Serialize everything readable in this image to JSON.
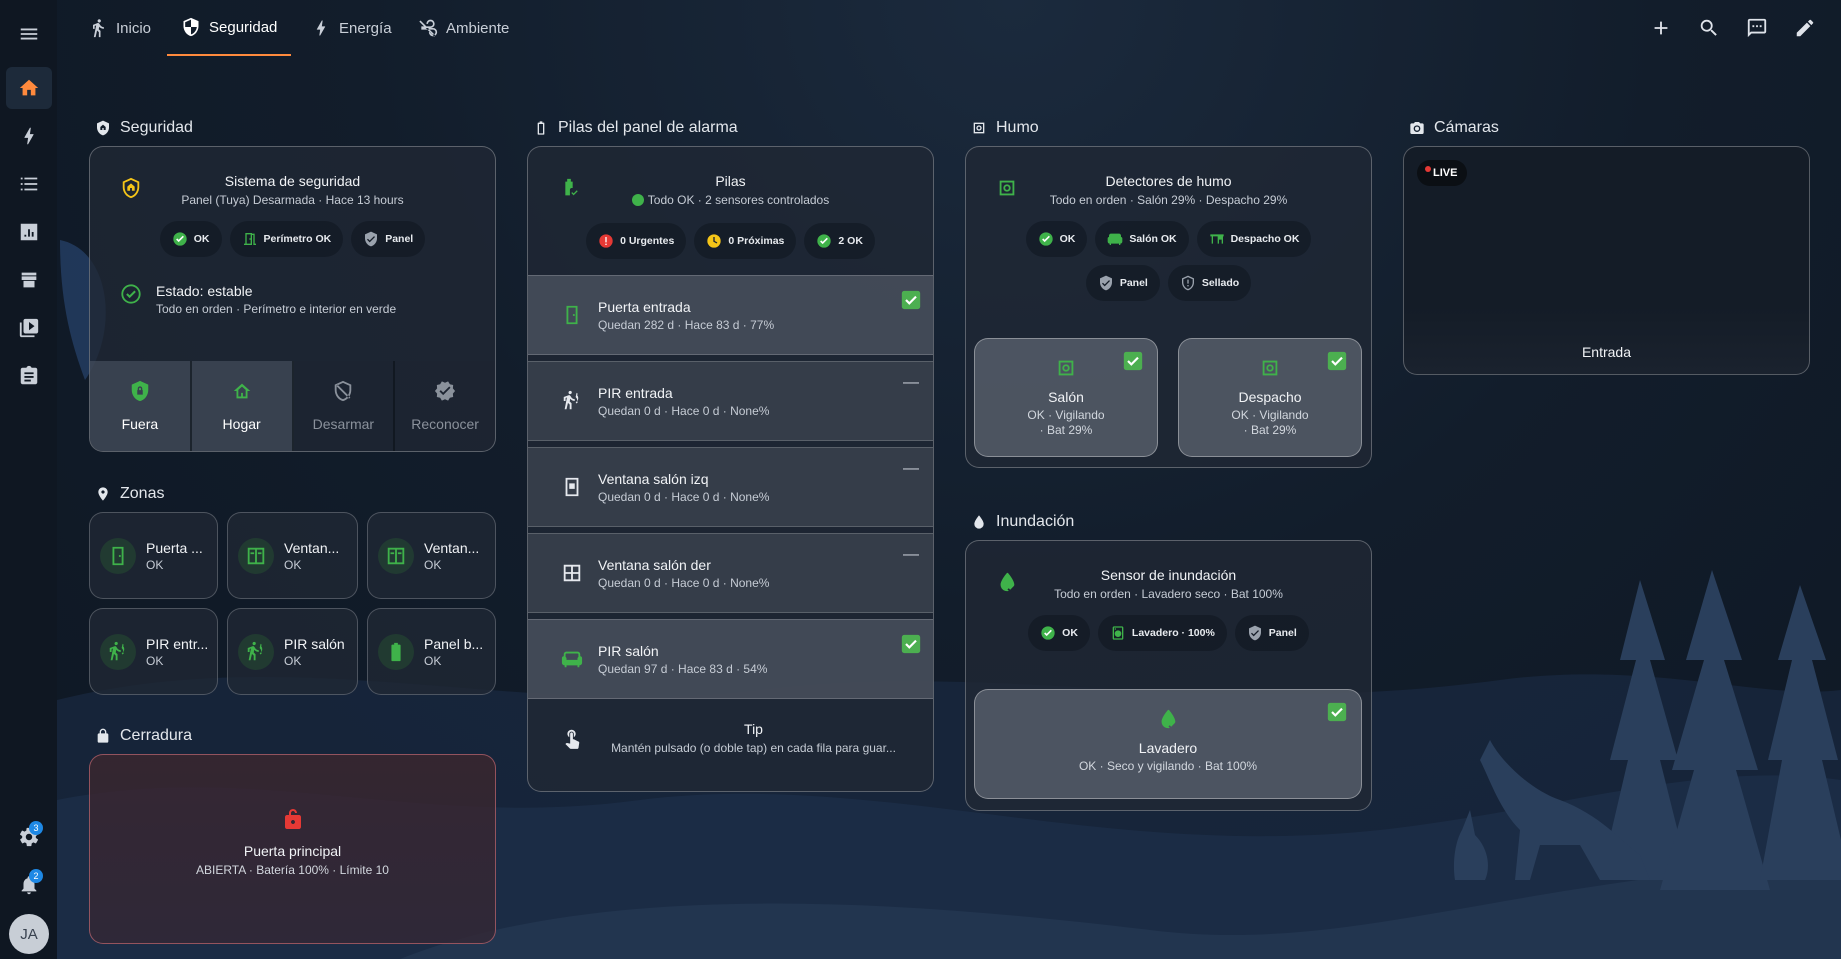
{
  "topbar": {
    "tabs": [
      {
        "label": "Inicio",
        "icon": "walk-icon",
        "active": false
      },
      {
        "label": "Seguridad",
        "icon": "shield-icon",
        "active": true
      },
      {
        "label": "Energía",
        "icon": "lightning-icon",
        "active": false
      },
      {
        "label": "Ambiente",
        "icon": "weather-icon",
        "active": false
      }
    ],
    "actions": [
      "add-icon",
      "search-icon",
      "chat-icon",
      "edit-icon"
    ]
  },
  "sidebar": {
    "items": [
      "home-icon",
      "energy-icon",
      "list-icon",
      "chart-icon",
      "store-icon",
      "media-icon",
      "clipboard-icon"
    ],
    "settings_badge": "3",
    "notifications_badge": "2",
    "avatar_initials": "JA"
  },
  "security": {
    "section_title": "Seguridad",
    "title": "Sistema de seguridad",
    "subtitle": "Panel (Tuya) Desarmada · Hace 13 hours",
    "chips": [
      "OK",
      "Perímetro OK",
      "Panel"
    ],
    "status_title": "Estado: estable",
    "status_detail": "Todo en orden · Perímetro e interior en verde",
    "modes": [
      {
        "label": "Fuera",
        "enabled": true
      },
      {
        "label": "Hogar",
        "enabled": true
      },
      {
        "label": "Desarmar",
        "enabled": false
      },
      {
        "label": "Reconocer",
        "enabled": false
      }
    ]
  },
  "zones": {
    "section_title": "Zonas",
    "items": [
      {
        "name": "Puerta ...",
        "state": "OK",
        "icon": "door-icon"
      },
      {
        "name": "Ventan...",
        "state": "OK",
        "icon": "window-icon"
      },
      {
        "name": "Ventan...",
        "state": "OK",
        "icon": "window-icon"
      },
      {
        "name": "PIR entr...",
        "state": "OK",
        "icon": "motion-sensor-icon"
      },
      {
        "name": "PIR salón",
        "state": "OK",
        "icon": "motion-sensor-icon"
      },
      {
        "name": "Panel b...",
        "state": "OK",
        "icon": "battery-icon"
      }
    ]
  },
  "lock": {
    "section_title": "Cerradura",
    "name": "Puerta principal",
    "detail": "ABIERTA · Batería 100% · Límite 10"
  },
  "batteries": {
    "section_title": "Pilas del panel de alarma",
    "title": "Pilas",
    "subtitle": "Todo OK · 2 sensores controlados",
    "chips": [
      "0 Urgentes",
      "0 Próximas",
      "2 OK"
    ],
    "rows": [
      {
        "name": "Puerta entrada",
        "detail": "Quedan 282 d · Hace 83 d · 77%",
        "flag": "check"
      },
      {
        "name": "PIR entrada",
        "detail": "Quedan 0 d · Hace 0 d · None%",
        "flag": "dash"
      },
      {
        "name": "Ventana salón izq",
        "detail": "Quedan 0 d · Hace 0 d · None%",
        "flag": "dash"
      },
      {
        "name": "Ventana salón der",
        "detail": "Quedan 0 d · Hace 0 d · None%",
        "flag": "dash"
      },
      {
        "name": "PIR salón",
        "detail": "Quedan 97 d · Hace 83 d · 54%",
        "flag": "check"
      }
    ],
    "tip_title": "Tip",
    "tip_text": "Mantén pulsado (o doble tap) en cada fila para guar..."
  },
  "smoke": {
    "section_title": "Humo",
    "title": "Detectores de humo",
    "subtitle": "Todo en orden · Salón 29% · Despacho 29%",
    "chips": [
      "OK",
      "Salón OK",
      "Despacho OK",
      "Panel",
      "Sellado"
    ],
    "detectors": [
      {
        "name": "Salón",
        "detail1": "OK · Vigilando",
        "detail2": "· Bat 29%"
      },
      {
        "name": "Despacho",
        "detail1": "OK · Vigilando",
        "detail2": "· Bat 29%"
      }
    ]
  },
  "flood": {
    "section_title": "Inundación",
    "title": "Sensor de inundación",
    "subtitle": "Todo en orden · Lavadero seco · Bat 100%",
    "chips": [
      "OK",
      "Lavadero · 100%",
      "Panel"
    ],
    "sensor_name": "Lavadero",
    "sensor_detail": "OK · Seco y vigilando · Bat 100%"
  },
  "cameras": {
    "section_title": "Cámaras",
    "live_label": "LIVE",
    "camera_name": "Entrada"
  }
}
